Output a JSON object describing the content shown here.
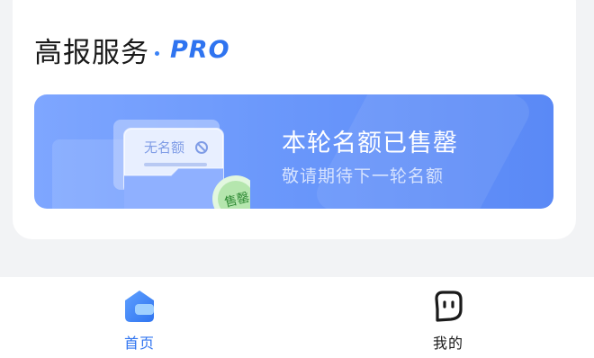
{
  "header": {
    "title": "高报服务",
    "badge": "PRO"
  },
  "banner": {
    "heading": "本轮名额已售罄",
    "subtext": "敬请期待下一轮名额",
    "card_label": "无名额",
    "stamp_label": "售罄"
  },
  "tabbar": {
    "items": [
      {
        "label": "首页",
        "icon": "home-icon",
        "active": true
      },
      {
        "label": "我的",
        "icon": "profile-face-icon",
        "active": false
      }
    ]
  },
  "colors": {
    "accent": "#2f74f0",
    "banner_start": "#7ea6ff",
    "banner_end": "#5a89f6",
    "background": "#f2f3f5"
  }
}
